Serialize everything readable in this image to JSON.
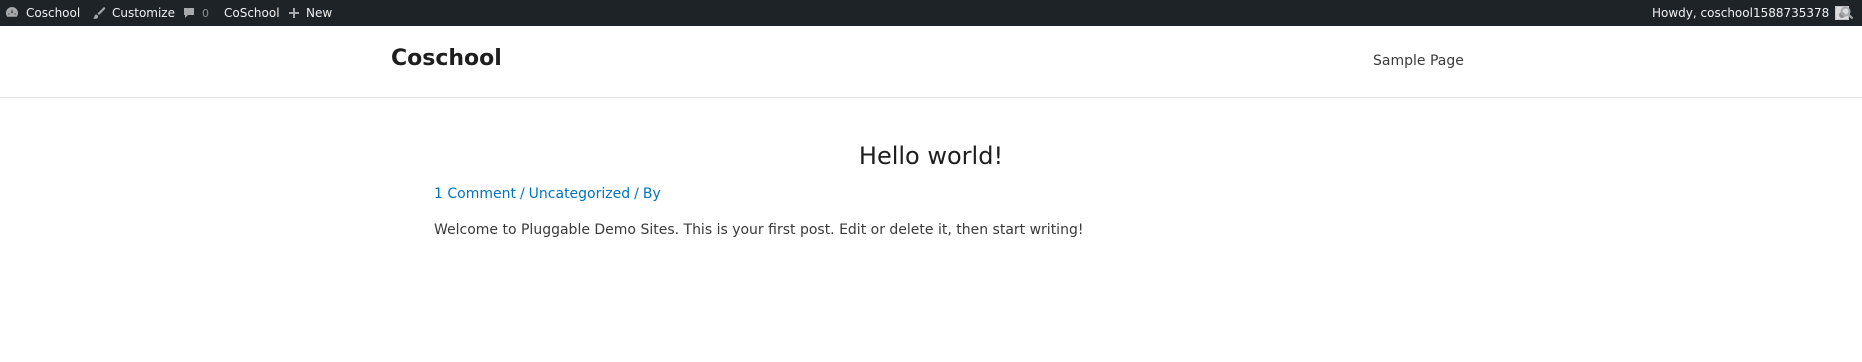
{
  "adminbar": {
    "site_name": "Coschool",
    "customize": "Customize",
    "comments_count": "0",
    "coschool": "CoSchool",
    "new": "New",
    "howdy": "Howdy, coschool1588735378"
  },
  "header": {
    "site_title": "Coschool",
    "nav": {
      "sample_page": "Sample Page"
    }
  },
  "post": {
    "title": "Hello world!",
    "meta": {
      "comments": "1 Comment",
      "sep1": "/",
      "category": "Uncategorized",
      "sep2": "/",
      "by": "By"
    },
    "body": "Welcome to Pluggable Demo Sites. This is your first post. Edit or delete it, then start writing!"
  }
}
